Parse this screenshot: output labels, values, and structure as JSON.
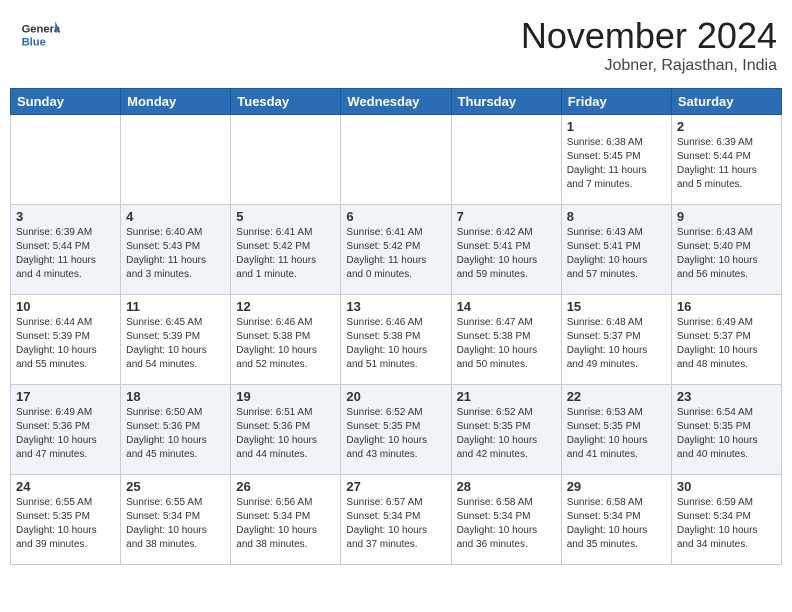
{
  "header": {
    "logo_general": "General",
    "logo_blue": "Blue",
    "month_title": "November 2024",
    "location": "Jobner, Rajasthan, India"
  },
  "weekdays": [
    "Sunday",
    "Monday",
    "Tuesday",
    "Wednesday",
    "Thursday",
    "Friday",
    "Saturday"
  ],
  "weeks": [
    [
      {
        "day": "",
        "info": ""
      },
      {
        "day": "",
        "info": ""
      },
      {
        "day": "",
        "info": ""
      },
      {
        "day": "",
        "info": ""
      },
      {
        "day": "",
        "info": ""
      },
      {
        "day": "1",
        "info": "Sunrise: 6:38 AM\nSunset: 5:45 PM\nDaylight: 11 hours\nand 7 minutes."
      },
      {
        "day": "2",
        "info": "Sunrise: 6:39 AM\nSunset: 5:44 PM\nDaylight: 11 hours\nand 5 minutes."
      }
    ],
    [
      {
        "day": "3",
        "info": "Sunrise: 6:39 AM\nSunset: 5:44 PM\nDaylight: 11 hours\nand 4 minutes."
      },
      {
        "day": "4",
        "info": "Sunrise: 6:40 AM\nSunset: 5:43 PM\nDaylight: 11 hours\nand 3 minutes."
      },
      {
        "day": "5",
        "info": "Sunrise: 6:41 AM\nSunset: 5:42 PM\nDaylight: 11 hours\nand 1 minute."
      },
      {
        "day": "6",
        "info": "Sunrise: 6:41 AM\nSunset: 5:42 PM\nDaylight: 11 hours\nand 0 minutes."
      },
      {
        "day": "7",
        "info": "Sunrise: 6:42 AM\nSunset: 5:41 PM\nDaylight: 10 hours\nand 59 minutes."
      },
      {
        "day": "8",
        "info": "Sunrise: 6:43 AM\nSunset: 5:41 PM\nDaylight: 10 hours\nand 57 minutes."
      },
      {
        "day": "9",
        "info": "Sunrise: 6:43 AM\nSunset: 5:40 PM\nDaylight: 10 hours\nand 56 minutes."
      }
    ],
    [
      {
        "day": "10",
        "info": "Sunrise: 6:44 AM\nSunset: 5:39 PM\nDaylight: 10 hours\nand 55 minutes."
      },
      {
        "day": "11",
        "info": "Sunrise: 6:45 AM\nSunset: 5:39 PM\nDaylight: 10 hours\nand 54 minutes."
      },
      {
        "day": "12",
        "info": "Sunrise: 6:46 AM\nSunset: 5:38 PM\nDaylight: 10 hours\nand 52 minutes."
      },
      {
        "day": "13",
        "info": "Sunrise: 6:46 AM\nSunset: 5:38 PM\nDaylight: 10 hours\nand 51 minutes."
      },
      {
        "day": "14",
        "info": "Sunrise: 6:47 AM\nSunset: 5:38 PM\nDaylight: 10 hours\nand 50 minutes."
      },
      {
        "day": "15",
        "info": "Sunrise: 6:48 AM\nSunset: 5:37 PM\nDaylight: 10 hours\nand 49 minutes."
      },
      {
        "day": "16",
        "info": "Sunrise: 6:49 AM\nSunset: 5:37 PM\nDaylight: 10 hours\nand 48 minutes."
      }
    ],
    [
      {
        "day": "17",
        "info": "Sunrise: 6:49 AM\nSunset: 5:36 PM\nDaylight: 10 hours\nand 47 minutes."
      },
      {
        "day": "18",
        "info": "Sunrise: 6:50 AM\nSunset: 5:36 PM\nDaylight: 10 hours\nand 45 minutes."
      },
      {
        "day": "19",
        "info": "Sunrise: 6:51 AM\nSunset: 5:36 PM\nDaylight: 10 hours\nand 44 minutes."
      },
      {
        "day": "20",
        "info": "Sunrise: 6:52 AM\nSunset: 5:35 PM\nDaylight: 10 hours\nand 43 minutes."
      },
      {
        "day": "21",
        "info": "Sunrise: 6:52 AM\nSunset: 5:35 PM\nDaylight: 10 hours\nand 42 minutes."
      },
      {
        "day": "22",
        "info": "Sunrise: 6:53 AM\nSunset: 5:35 PM\nDaylight: 10 hours\nand 41 minutes."
      },
      {
        "day": "23",
        "info": "Sunrise: 6:54 AM\nSunset: 5:35 PM\nDaylight: 10 hours\nand 40 minutes."
      }
    ],
    [
      {
        "day": "24",
        "info": "Sunrise: 6:55 AM\nSunset: 5:35 PM\nDaylight: 10 hours\nand 39 minutes."
      },
      {
        "day": "25",
        "info": "Sunrise: 6:55 AM\nSunset: 5:34 PM\nDaylight: 10 hours\nand 38 minutes."
      },
      {
        "day": "26",
        "info": "Sunrise: 6:56 AM\nSunset: 5:34 PM\nDaylight: 10 hours\nand 38 minutes."
      },
      {
        "day": "27",
        "info": "Sunrise: 6:57 AM\nSunset: 5:34 PM\nDaylight: 10 hours\nand 37 minutes."
      },
      {
        "day": "28",
        "info": "Sunrise: 6:58 AM\nSunset: 5:34 PM\nDaylight: 10 hours\nand 36 minutes."
      },
      {
        "day": "29",
        "info": "Sunrise: 6:58 AM\nSunset: 5:34 PM\nDaylight: 10 hours\nand 35 minutes."
      },
      {
        "day": "30",
        "info": "Sunrise: 6:59 AM\nSunset: 5:34 PM\nDaylight: 10 hours\nand 34 minutes."
      }
    ]
  ]
}
